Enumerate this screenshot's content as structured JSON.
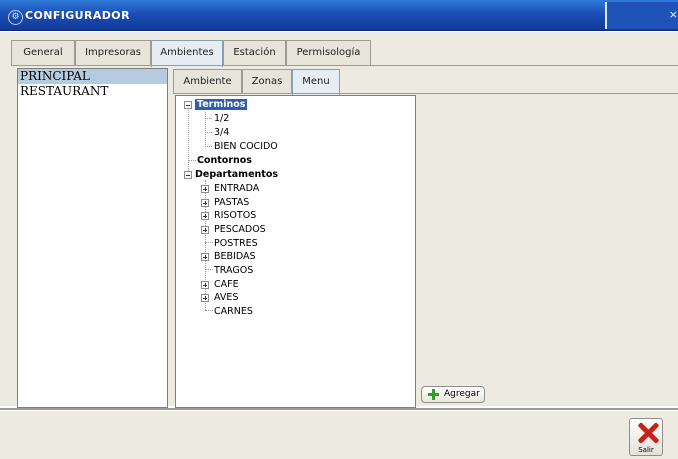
{
  "window": {
    "title": "CONFIGURADOR",
    "close_glyph": "×"
  },
  "main_tabs": [
    {
      "label": "General"
    },
    {
      "label": "Impresoras"
    },
    {
      "label": "Ambientes",
      "active": true
    },
    {
      "label": "Estación"
    },
    {
      "label": "Permisología"
    }
  ],
  "ambientes_list": [
    "PRINCIPAL",
    "RESTAURANT"
  ],
  "ambientes_selected": "PRINCIPAL",
  "sub_tabs": [
    {
      "label": "Ambiente"
    },
    {
      "label": "Zonas"
    },
    {
      "label": "Menu",
      "active": true
    }
  ],
  "tree": {
    "terminos": {
      "label": "Terminos",
      "children": [
        "1/2",
        "3/4",
        "BIEN COCIDO"
      ]
    },
    "contornos": {
      "label": "Contornos"
    },
    "departamentos": {
      "label": "Departamentos",
      "children": [
        "ENTRADA",
        "PASTAS",
        "RISOTOS",
        "PESCADOS",
        "POSTRES",
        "BEBIDAS",
        "TRAGOS",
        "CAFE",
        "AVES",
        "CARNES"
      ]
    }
  },
  "buttons": {
    "add_label": "Agregar",
    "exit_label": "Salir"
  },
  "icons": {
    "app": "app-logo-icon",
    "add": "green-plus-icon",
    "exit": "red-x-icon"
  },
  "colors": {
    "titlebar": "#1b4fb6",
    "selection": "#2f5fac",
    "list_selection": "#b5cce0",
    "panel_bg": "#eceae1"
  }
}
